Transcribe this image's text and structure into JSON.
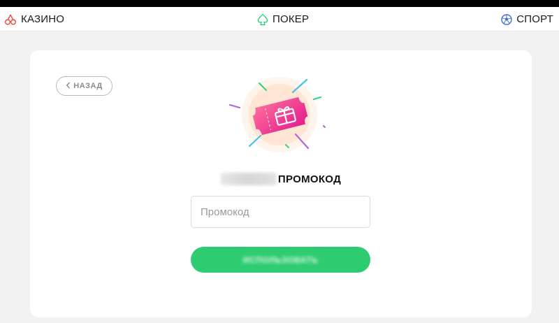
{
  "nav": {
    "casino_label": "КАЗИНО",
    "poker_label": "ПОКЕР",
    "sport_label": "СПОРТ"
  },
  "card": {
    "back_label": "НАЗАД",
    "title_suffix": "ПРОМОКОД",
    "promo_placeholder": "Промокод",
    "use_button_label": "ИСПОЛЬЗОВАТЬ"
  },
  "icons": {
    "casino": "cherries-icon",
    "poker": "spade-icon",
    "sport": "soccer-ball-icon",
    "back": "chevron-left-icon",
    "hero": "gift-ticket-icon"
  },
  "colors": {
    "accent_green": "#2ecc71",
    "ticket_pink": "#f0368e",
    "casino_icon": "#e8473c",
    "poker_icon": "#2ecc71",
    "sport_icon": "#3f6fd8"
  }
}
